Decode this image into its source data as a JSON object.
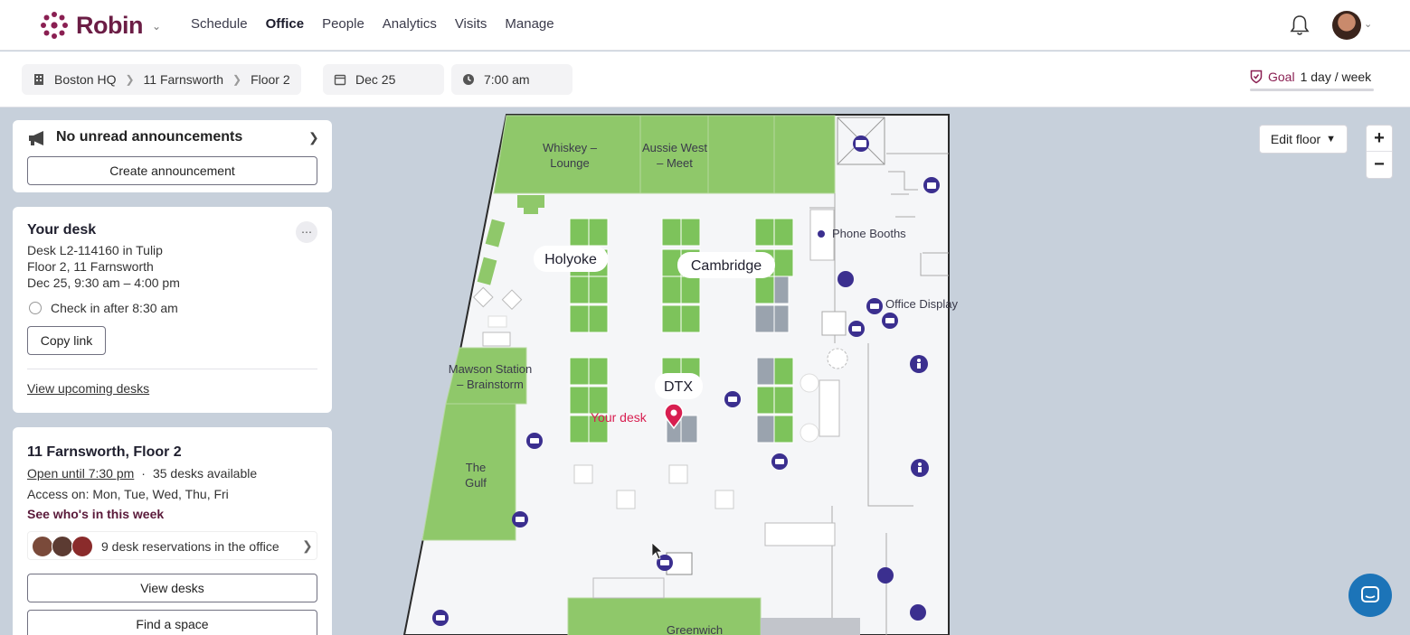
{
  "brand": {
    "name": "Robin"
  },
  "nav": {
    "items": [
      "Schedule",
      "Office",
      "People",
      "Analytics",
      "Visits",
      "Manage"
    ],
    "active": "Office"
  },
  "breadcrumb": {
    "building": "Boston HQ",
    "address": "11 Farnsworth",
    "floor": "Floor 2"
  },
  "date": "Dec 25",
  "time": "7:00 am",
  "goal": {
    "label": "Goal",
    "value": "1 day / week"
  },
  "announcements": {
    "title": "No unread announcements",
    "create_label": "Create announcement"
  },
  "your_desk": {
    "title": "Your desk",
    "desk": "Desk L2-114160 in Tulip",
    "location": "Floor 2, 11 Farnsworth",
    "when": "Dec 25, 9:30 am – 4:00 pm",
    "checkin": "Check in after 8:30 am",
    "copy_link": "Copy link",
    "view_upcoming": "View upcoming desks"
  },
  "floor_card": {
    "title": "11 Farnsworth, Floor 2",
    "open_until": "Open until 7:30 pm",
    "separator": "·",
    "desks_available": "35 desks available",
    "access": "Access on: Mon, Tue, Wed, Thu, Fri",
    "see_who": "See who's in this week",
    "reservations": "9 desk reservations in the office",
    "view_desks": "View desks",
    "find_space": "Find a space"
  },
  "map": {
    "edit_floor": "Edit floor",
    "zoom_in": "+",
    "zoom_out": "−",
    "labels": {
      "whiskey": "Whiskey – Lounge",
      "aussie": "Aussie West – Meet",
      "phone_booths": "Phone Booths",
      "office_display": "Office Display",
      "holyoke": "Holyoke",
      "cambridge": "Cambridge",
      "mawson": "Mawson Station – Brainstorm",
      "dtx": "DTX",
      "your_desk": "Your desk",
      "the_gulf": "The Gulf",
      "greenwich": "Greenwich"
    }
  },
  "colors": {
    "brand": "#6b1d45",
    "accent": "#8a1f52",
    "room_green": "#8fc86a",
    "desk_green": "#7dc35b",
    "icon_navy": "#3b2f8f",
    "pin_red": "#d81e50"
  }
}
